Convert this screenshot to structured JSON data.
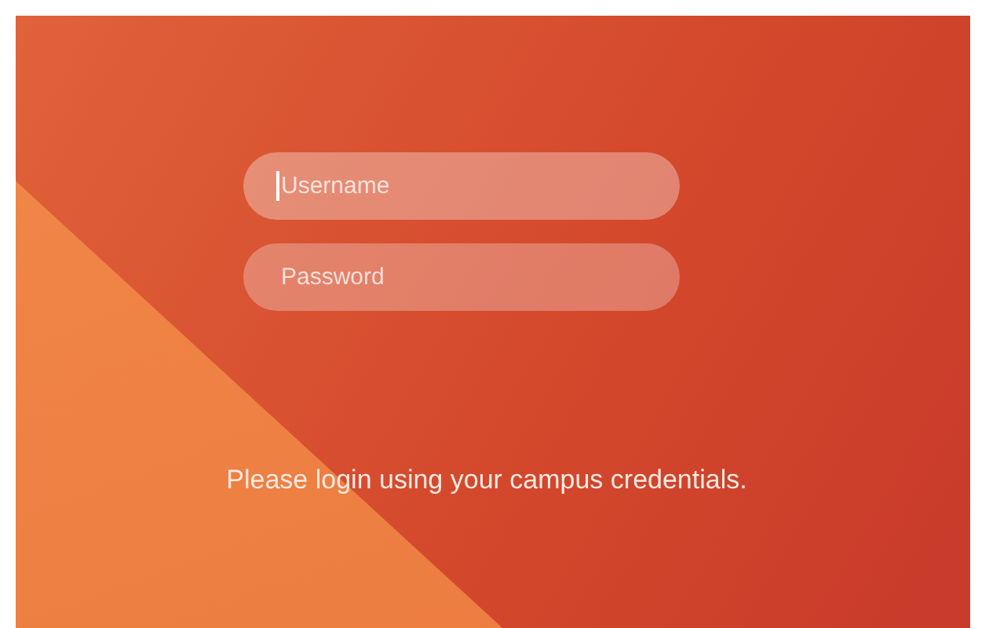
{
  "login_form": {
    "fields": [
      {
        "placeholder": "Username",
        "focused": true
      },
      {
        "placeholder": "Password",
        "focused": false
      }
    ]
  },
  "message": "Please login using your campus credentials."
}
